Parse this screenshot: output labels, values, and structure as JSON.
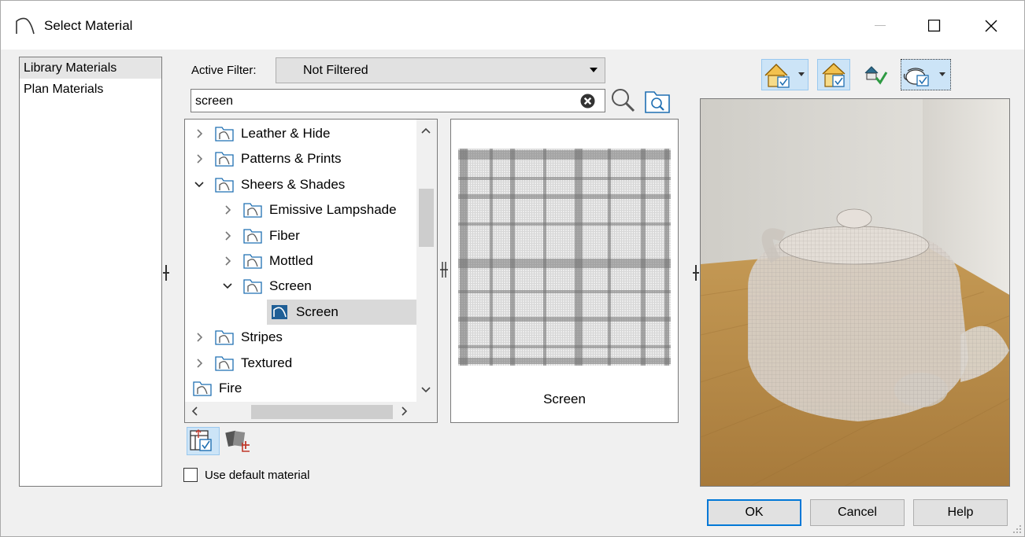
{
  "window": {
    "title": "Select Material"
  },
  "sidebar": {
    "items": [
      {
        "label": "Library Materials",
        "selected": true
      },
      {
        "label": "Plan Materials",
        "selected": false
      }
    ]
  },
  "filter": {
    "label": "Active Filter:",
    "value": "Not Filtered"
  },
  "search": {
    "value": "screen"
  },
  "tree": {
    "items": [
      {
        "label": "Leather & Hide",
        "depth": 1,
        "expand": "collapsed"
      },
      {
        "label": "Patterns & Prints",
        "depth": 1,
        "expand": "collapsed"
      },
      {
        "label": "Sheers & Shades",
        "depth": 1,
        "expand": "expanded"
      },
      {
        "label": "Emissive Lampshade",
        "depth": 2,
        "expand": "collapsed"
      },
      {
        "label": "Fiber",
        "depth": 2,
        "expand": "collapsed"
      },
      {
        "label": "Mottled",
        "depth": 2,
        "expand": "collapsed"
      },
      {
        "label": "Screen",
        "depth": 2,
        "expand": "expanded"
      },
      {
        "label": "Screen",
        "depth": 3,
        "expand": "none",
        "selected": true,
        "material": true
      },
      {
        "label": "Stripes",
        "depth": 1,
        "expand": "collapsed"
      },
      {
        "label": "Textured",
        "depth": 1,
        "expand": "collapsed"
      },
      {
        "label": "Fire",
        "depth": 0,
        "expand": "none"
      }
    ]
  },
  "preview": {
    "name": "Screen"
  },
  "options": {
    "use_default_label": "Use default material",
    "use_default_checked": false
  },
  "buttons": {
    "ok": "OK",
    "cancel": "Cancel",
    "help": "Help"
  },
  "colors": {
    "accent": "#0078d7",
    "selection": "#d9d9d9",
    "floor": "#b58a4a",
    "wall": "#e4e2dd"
  }
}
